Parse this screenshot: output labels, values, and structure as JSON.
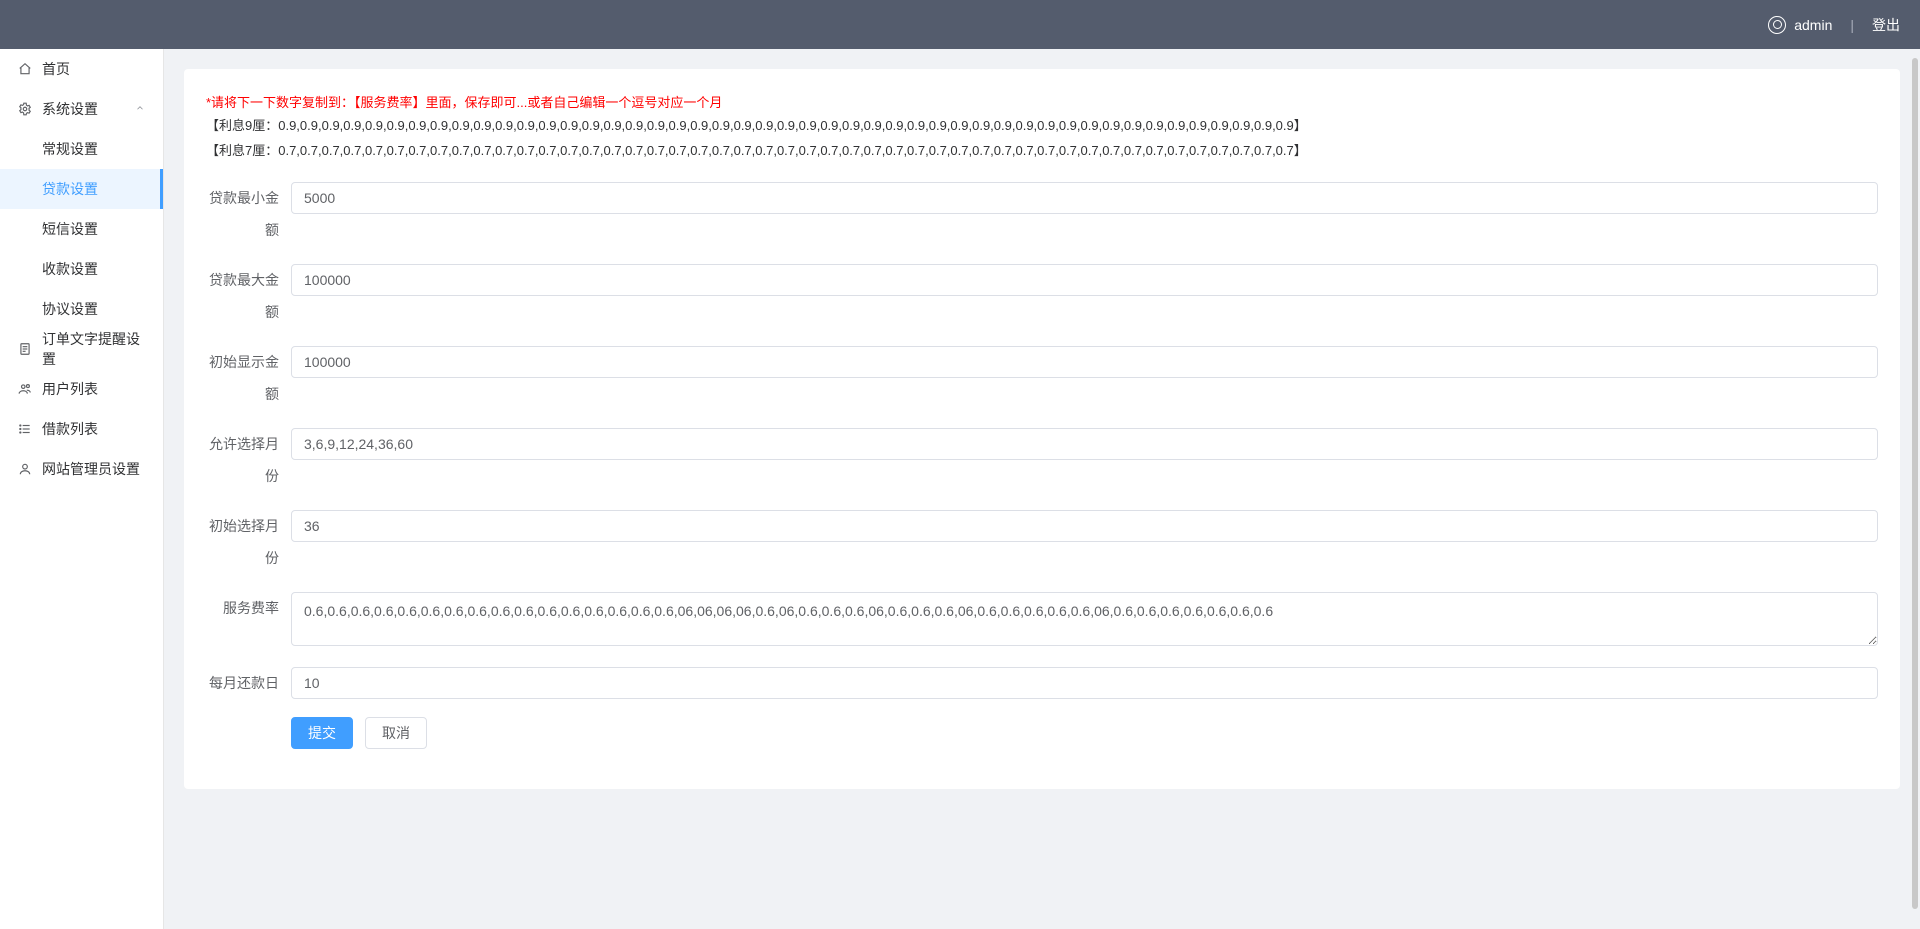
{
  "header": {
    "username": "admin",
    "logout": "登出",
    "separator": "|"
  },
  "sidebar": {
    "items": [
      {
        "key": "home",
        "label": "首页",
        "icon": "home"
      },
      {
        "key": "sys",
        "label": "系统设置",
        "icon": "gear",
        "expanded": true
      },
      {
        "key": "reminder",
        "label": "订单文字提醒设置",
        "icon": "doc"
      },
      {
        "key": "users",
        "label": "用户列表",
        "icon": "users"
      },
      {
        "key": "loans",
        "label": "借款列表",
        "icon": "list"
      },
      {
        "key": "admins",
        "label": "网站管理员设置",
        "icon": "person"
      }
    ],
    "sys_sub": [
      {
        "key": "general",
        "label": "常规设置"
      },
      {
        "key": "loan",
        "label": "贷款设置",
        "active": true
      },
      {
        "key": "sms",
        "label": "短信设置"
      },
      {
        "key": "payment",
        "label": "收款设置"
      },
      {
        "key": "agreement",
        "label": "协议设置"
      }
    ]
  },
  "intro": {
    "hint": "*请将下一下数字复制到：【服务费率】里面，保存即可...或者自己编辑一个逗号对应一个月",
    "line9": "【利息9厘：0.9,0.9,0.9,0.9,0.9,0.9,0.9,0.9,0.9,0.9,0.9,0.9,0.9,0.9,0.9,0.9,0.9,0.9,0.9,0.9,0.9,0.9,0.9,0.9,0.9,0.9,0.9,0.9,0.9,0.9,0.9,0.9,0.9,0.9,0.9,0.9,0.9,0.9,0.9,0.9,0.9,0.9,0.9,0.9,0.9,0.9,0.9】",
    "line7": "【利息7厘：0.7,0.7,0.7,0.7,0.7,0.7,0.7,0.7,0.7,0.7,0.7,0.7,0.7,0.7,0.7,0.7,0.7,0.7,0.7,0.7,0.7,0.7,0.7,0.7,0.7,0.7,0.7,0.7,0.7,0.7,0.7,0.7,0.7,0.7,0.7,0.7,0.7,0.7,0.7,0.7,0.7,0.7,0.7,0.7,0.7,0.7,0.7】"
  },
  "form": {
    "min_loan": {
      "label": "贷款最小金额",
      "value": "5000"
    },
    "max_loan": {
      "label": "贷款最大金额",
      "value": "100000"
    },
    "init_display": {
      "label": "初始显示金额",
      "value": "100000"
    },
    "months_allowed": {
      "label": "允许选择月份",
      "value": "3,6,9,12,24,36,60"
    },
    "init_month": {
      "label": "初始选择月份",
      "value": "36"
    },
    "service_rate": {
      "label": "服务费率",
      "value": "0.6,0.6,0.6,0.6,0.6,0.6,0.6,0.6,0.6,0.6,0.6,0.6,0.6,0.6,0.6,0.6,06,06,06,06,0.6,06,0.6,0.6,0.6,06,0.6,0.6,0.6,06,0.6,0.6,0.6,0.6,0.6,06,0.6,0.6,0.6,0.6,0.6,0.6,0.6"
    },
    "repay_day": {
      "label": "每月还款日",
      "value": "10"
    },
    "submit": "提交",
    "cancel": "取消"
  }
}
